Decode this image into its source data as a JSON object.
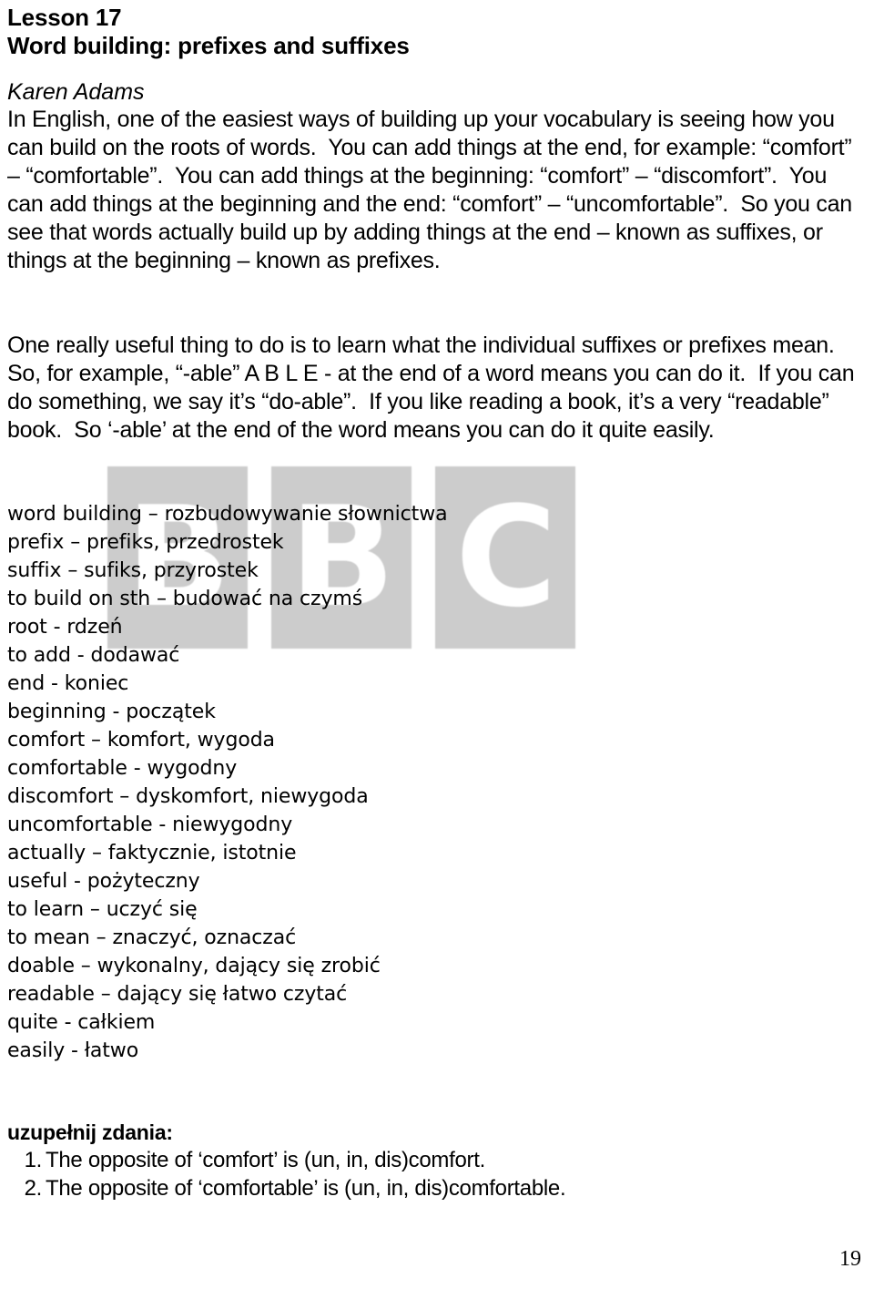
{
  "document": {
    "lesson_number": "Lesson 17",
    "lesson_title": "Word building: prefixes and suffixes",
    "author": "Karen Adams",
    "page_number": "19",
    "watermark": {
      "letters": [
        "B",
        "B",
        "C"
      ],
      "box_color": "#cccccc",
      "letter_color": "#ffffff"
    },
    "paragraphs": {
      "p1": "In English, one of the easiest ways of building up your vocabulary is seeing how you can build on the roots of words.  You can add things at the end, for example: “comfort” – “comfortable”.  You can add things at the beginning: “comfort” – “discomfort”.  You can add things at the beginning and the end: “comfort” – “uncomfortable”.  So you can see that words actually build up by adding things at the end – known as suffixes, or things at the beginning – known as prefixes.",
      "p2": "One really useful thing to do is to learn what the individual suffixes or prefixes mean.  So, for example, “-able” A B L E - at the end of a word means you can do it.  If you can do something, we say it’s “do-able”.  If you like reading a book, it’s a very “readable” book.  So ‘-able’ at the end of the word means you can do it quite easily."
    },
    "vocabulary": [
      "word building – rozbudowywanie słownictwa",
      "prefix – prefiks, przedrostek",
      "suffix – sufiks, przyrostek",
      "to build on sth – budować na czymś",
      "root - rdzeń",
      "to add - dodawać",
      "end - koniec",
      "beginning - początek",
      "comfort – komfort, wygoda",
      "comfortable - wygodny",
      "discomfort – dyskomfort, niewygoda",
      "uncomfortable - niewygodny",
      "actually – faktycznie, istotnie",
      "useful - pożyteczny",
      "to learn – uczyć się",
      "to mean – znaczyć, oznaczać",
      "doable – wykonalny, dający się zrobić",
      "readable – dający się łatwo czytać",
      "quite - całkiem",
      "easily - łatwo"
    ],
    "exercise": {
      "heading": "uzupełnij zdania:",
      "items": [
        {
          "number": "1.",
          "text": "The opposite of ‘comfort’ is (un, in, dis)comfort."
        },
        {
          "number": "2.",
          "text": "The opposite of ‘comfortable’ is (un, in, dis)comfortable."
        }
      ]
    }
  }
}
